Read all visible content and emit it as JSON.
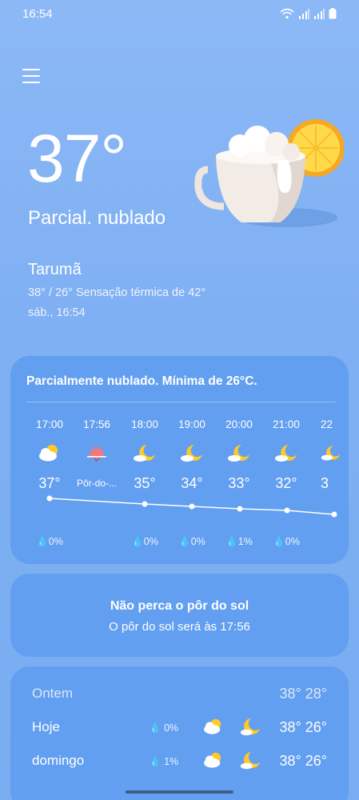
{
  "status_bar": {
    "time": "16:54"
  },
  "current": {
    "temperature": "37°",
    "condition": "Parcial. nublado",
    "location": "Tarumã",
    "details": "38° / 26° Sensação térmica de 42°",
    "date": "sáb., 16:54"
  },
  "hourly": {
    "title": "Parcialmente nublado. Mínima de 26°C.",
    "items": [
      {
        "time": "17:00",
        "icon": "partly-cloudy-icon",
        "temp": "37°",
        "rain": "0%"
      },
      {
        "time": "17:56",
        "icon": "sunset-icon",
        "temp": "Pôr-do-...",
        "rain": ""
      },
      {
        "time": "18:00",
        "icon": "moon-cloud-icon",
        "temp": "35°",
        "rain": "0%"
      },
      {
        "time": "19:00",
        "icon": "moon-cloud-icon",
        "temp": "34°",
        "rain": "0%"
      },
      {
        "time": "20:00",
        "icon": "moon-cloud-icon",
        "temp": "33°",
        "rain": "1%"
      },
      {
        "time": "21:00",
        "icon": "moon-cloud-icon",
        "temp": "32°",
        "rain": "0%"
      },
      {
        "time": "22",
        "icon": "moon-cloud-icon",
        "temp": "3",
        "rain": ""
      }
    ]
  },
  "sunset_card": {
    "title": "Não perca o pôr do sol",
    "subtitle": "O pôr do sol será às 17:56"
  },
  "daily": [
    {
      "day": "Ontem",
      "rain": "",
      "temps": "38° 28°"
    },
    {
      "day": "Hoje",
      "rain": "0%",
      "temps": "38° 26°"
    },
    {
      "day": "domingo",
      "rain": "1%",
      "temps": "38° 26°"
    }
  ]
}
